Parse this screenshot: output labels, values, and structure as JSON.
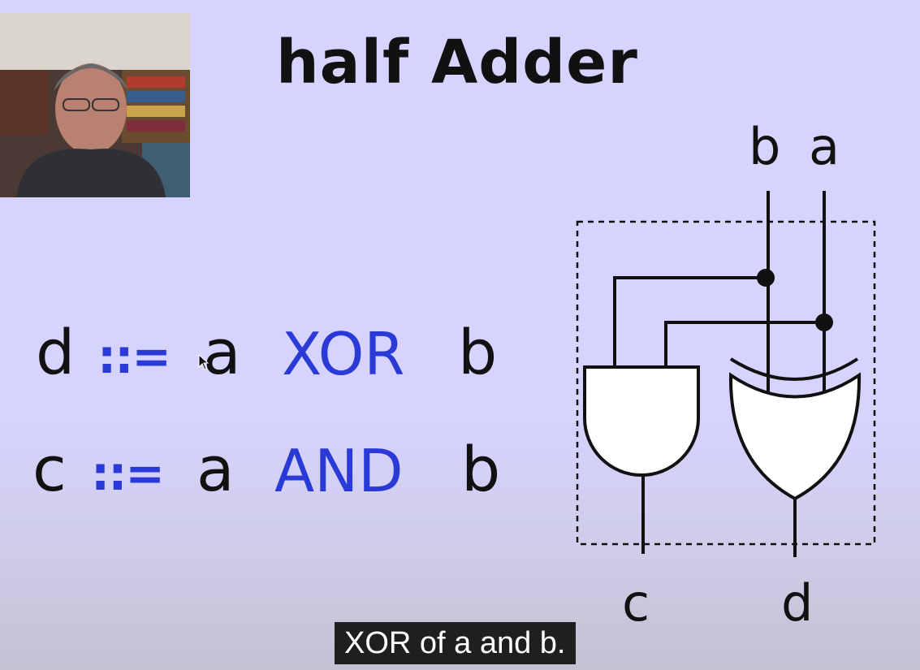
{
  "slide": {
    "title": "half Adder",
    "equations": [
      {
        "lhs": "d",
        "assign": "::=",
        "a": "a",
        "op": "XOR",
        "b": "b"
      },
      {
        "lhs": "c",
        "assign": "::=",
        "a": "a",
        "op": "AND",
        "b": "b"
      }
    ],
    "circuit": {
      "inputs": [
        "b",
        "a"
      ],
      "outputs": [
        "c",
        "d"
      ],
      "gates": [
        "AND",
        "XOR"
      ]
    }
  },
  "caption": {
    "text": "XOR of a and b."
  },
  "colors": {
    "background": "#d6d3ff",
    "operator": "#2a3ad6",
    "text": "#111111",
    "caption_bg": "#1f1f1f"
  },
  "icons": {
    "cursor": "mouse-pointer-icon"
  }
}
